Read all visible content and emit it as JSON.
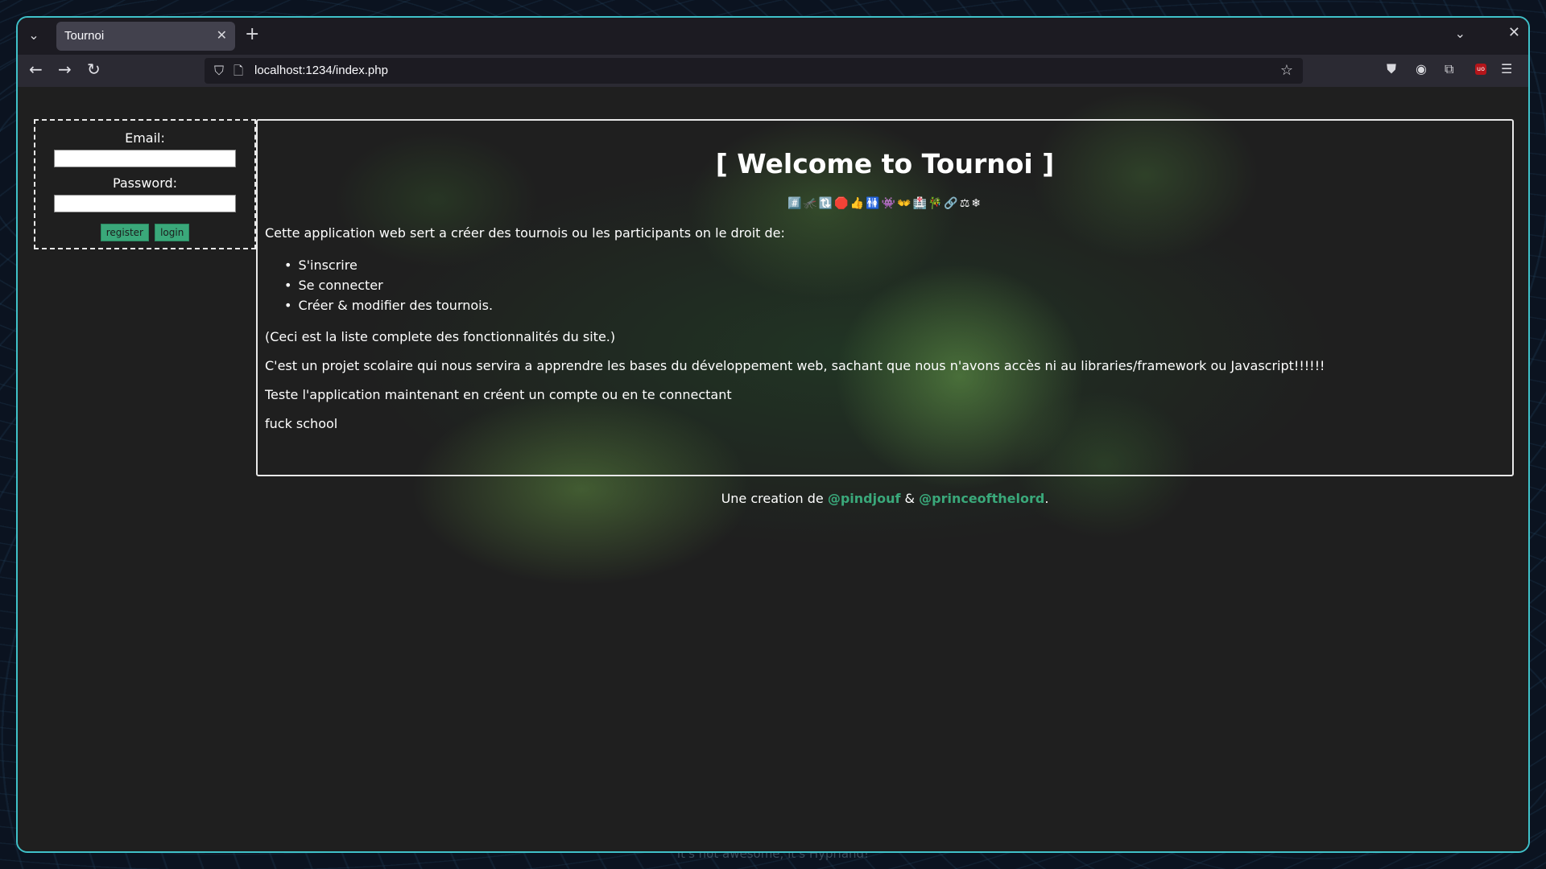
{
  "desktop": {
    "caption": "it's not awesome, it's Hyprland!"
  },
  "browser": {
    "tab": {
      "title": "Tournoi",
      "close_glyph": "✕"
    },
    "new_tab_glyph": "+",
    "tab_list_glyph": "⌄",
    "window_close_glyph": "✕",
    "nav": {
      "back_glyph": "←",
      "forward_glyph": "→",
      "reload_glyph": "↻"
    },
    "url": "localhost:1234/index.php",
    "toolbar_icons": [
      "pocket-icon",
      "account-icon",
      "extensions-icon",
      "ublock-icon",
      "menu-icon"
    ],
    "ublock_badge": "uo"
  },
  "login": {
    "email_label": "Email:",
    "password_label": "Password:",
    "email_value": "",
    "password_value": "",
    "register_label": "register",
    "login_label": "login"
  },
  "main": {
    "title": "[ Welcome to Tournoi ]",
    "emojis": "#️⃣🦟🔃🛑👍🚻👾👐🏥🎋🔗⚖❄",
    "intro": "Cette application web sert a créer des tournois ou les participants on le droit de:",
    "features": [
      "S'inscrire",
      "Se connecter",
      "Créer & modifier des tournois."
    ],
    "note": "(Ceci est la liste complete des fonctionnalités du site.)",
    "project": "C'est un projet scolaire qui nous servira a apprendre les bases du développement web, sachant que nous n'avons accès ni au libraries/framework ou Javascript!!!!!!",
    "cta": "Teste l'application maintenant en créent un compte ou en te connectant",
    "closing": "fuck school"
  },
  "footer": {
    "prefix": "Une creation de",
    "author1": "@pindjouf",
    "joiner": "&",
    "author2": "@princeofthelord",
    "suffix": "."
  },
  "colors": {
    "window_border": "#3fc1c9",
    "accent_green": "#3aa87a",
    "tab_active": "#42414d",
    "nav_bg": "#2b2a33"
  }
}
